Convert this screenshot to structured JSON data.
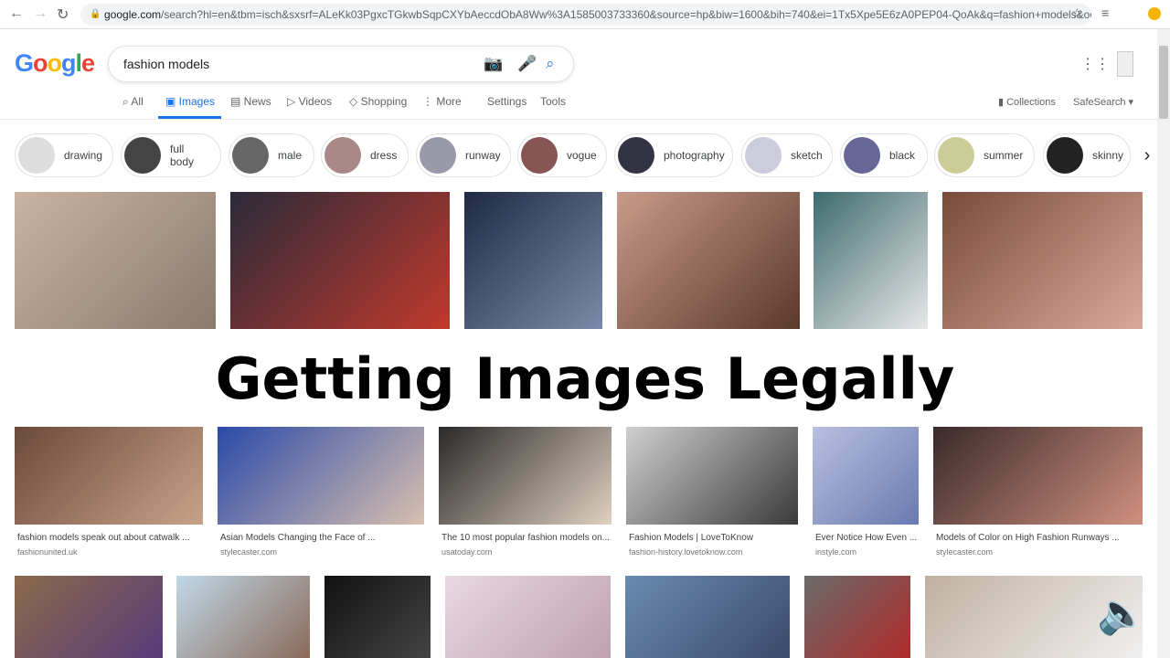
{
  "browser": {
    "url_host": "google.com",
    "url_rest": "/search?hl=en&tbm=isch&sxsrf=ALeKk03PgxcTGkwbSqpCXYbAeccdObA8Ww%3A1585003733360&source=hp&biw=1600&bih=740&ei=1Tx5Xpe5E6zA0PEP04-QoAk&q=fashion+models&oq=fashi..."
  },
  "logo": "Google",
  "search": {
    "value": "fashion models"
  },
  "tabs": [
    {
      "label": "All"
    },
    {
      "label": "Images"
    },
    {
      "label": "News"
    },
    {
      "label": "Videos"
    },
    {
      "label": "Shopping"
    },
    {
      "label": "More"
    },
    {
      "label": "Settings"
    },
    {
      "label": "Tools"
    }
  ],
  "right_links": {
    "collections": "Collections",
    "safesearch": "SafeSearch ▾"
  },
  "chips": [
    "drawing",
    "full body",
    "male",
    "dress",
    "runway",
    "vogue",
    "photography",
    "sketch",
    "black",
    "summer",
    "skinny"
  ],
  "overlay_title": "Getting Images Legally",
  "results_row2": [
    {
      "caption": "fashion models speak out about catwalk ...",
      "source": "fashionunited.uk"
    },
    {
      "caption": "Asian Models Changing the Face of ...",
      "source": "stylecaster.com"
    },
    {
      "caption": "The 10 most popular fashion models on...",
      "source": "usatoday.com"
    },
    {
      "caption": "Fashion Models | LoveToKnow",
      "source": "fashion-history.lovetoknow.com"
    },
    {
      "caption": "Ever Notice How Even ...",
      "source": "instyle.com"
    },
    {
      "caption": "Models of Color on High Fashion Runways ...",
      "source": "stylecaster.com"
    }
  ],
  "colors": {
    "accent": "#1a73e8"
  }
}
